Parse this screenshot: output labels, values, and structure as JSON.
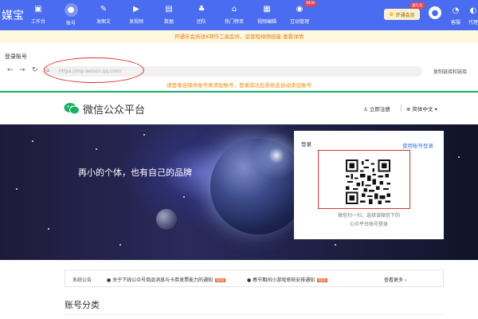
{
  "app": {
    "logo_text": "媒宝"
  },
  "nav": {
    "items": [
      {
        "key": "workbench",
        "label": "工作台",
        "icon": "▣"
      },
      {
        "key": "account",
        "label": "账号",
        "icon": "●",
        "active": true
      },
      {
        "key": "publish_article",
        "label": "发图文",
        "icon": "✎"
      },
      {
        "key": "publish_video",
        "label": "发视频",
        "icon": "▶"
      },
      {
        "key": "data",
        "label": "数据",
        "icon": "▤"
      },
      {
        "key": "team",
        "label": "团队",
        "icon": "♣"
      },
      {
        "key": "hot_list",
        "label": "热门榜单",
        "icon": "⌂"
      },
      {
        "key": "video_edit",
        "label": "视频编辑",
        "icon": "▦"
      },
      {
        "key": "interaction",
        "label": "互动管理",
        "icon": "◉",
        "badge": "NEW"
      }
    ],
    "vip_label": "开通会员",
    "vip_tag": "送礼包",
    "service_label": "客服",
    "agent_label": "代理"
  },
  "notice": {
    "text": "开通年会员送8项作工具会员，运营短视频技能 查看详情"
  },
  "dialog": {
    "title": "登录账号",
    "url": "https://mp.weixin.qq.com/",
    "copy_label": "复制链接和链接",
    "tip": "请登录自媒体账号来添加账号，登录成功后系统会自动添加账号"
  },
  "wechat": {
    "title": "微信公众平台",
    "register": "立即注册",
    "language": "简体中文",
    "slogan": "再小的个体，也有自己的品牌",
    "login_title": "登录",
    "login_alt": "使用账号登录",
    "qr_hint_line1": "微信扫一扫，选择该微信下的",
    "qr_hint_line2": "公众平台账号登录"
  },
  "announcements": {
    "label": "系统公告",
    "items": [
      {
        "text": "关于下线公众号商品消息与卡券发票能力的通知",
        "badge": "NEW"
      },
      {
        "text": "春节期间小游戏审核安排通知",
        "badge": "NEW"
      }
    ],
    "more": "查看更多"
  },
  "section_title": "账号分类",
  "colors": {
    "brand_blue": "#4a6cf0",
    "wechat_green": "#19b163",
    "warning_orange": "#f08a00",
    "highlight_red": "#e03030"
  }
}
